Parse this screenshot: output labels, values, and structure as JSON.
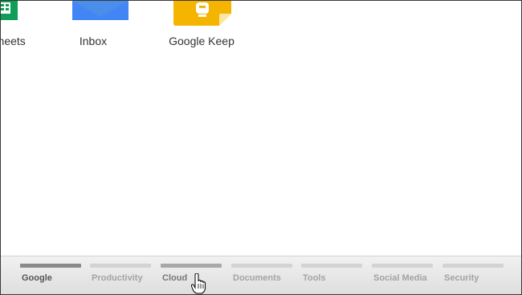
{
  "apps": [
    {
      "label": "Sheets",
      "icon": "sheets-icon",
      "color": "#0f9d58"
    },
    {
      "label": "Inbox",
      "icon": "inbox-icon",
      "color": "#4285f4"
    },
    {
      "label": "Google Keep",
      "icon": "google-keep-icon",
      "color": "#f4b400"
    }
  ],
  "tabs": [
    {
      "label": "Google",
      "state": "active"
    },
    {
      "label": "Productivity",
      "state": "normal"
    },
    {
      "label": "Cloud",
      "state": "hover"
    },
    {
      "label": "Documents",
      "state": "normal"
    },
    {
      "label": "Tools",
      "state": "normal"
    },
    {
      "label": "Social Media",
      "state": "normal"
    },
    {
      "label": "Security",
      "state": "normal"
    }
  ],
  "cursor": {
    "icon": "hand-pointer-cursor-icon"
  }
}
